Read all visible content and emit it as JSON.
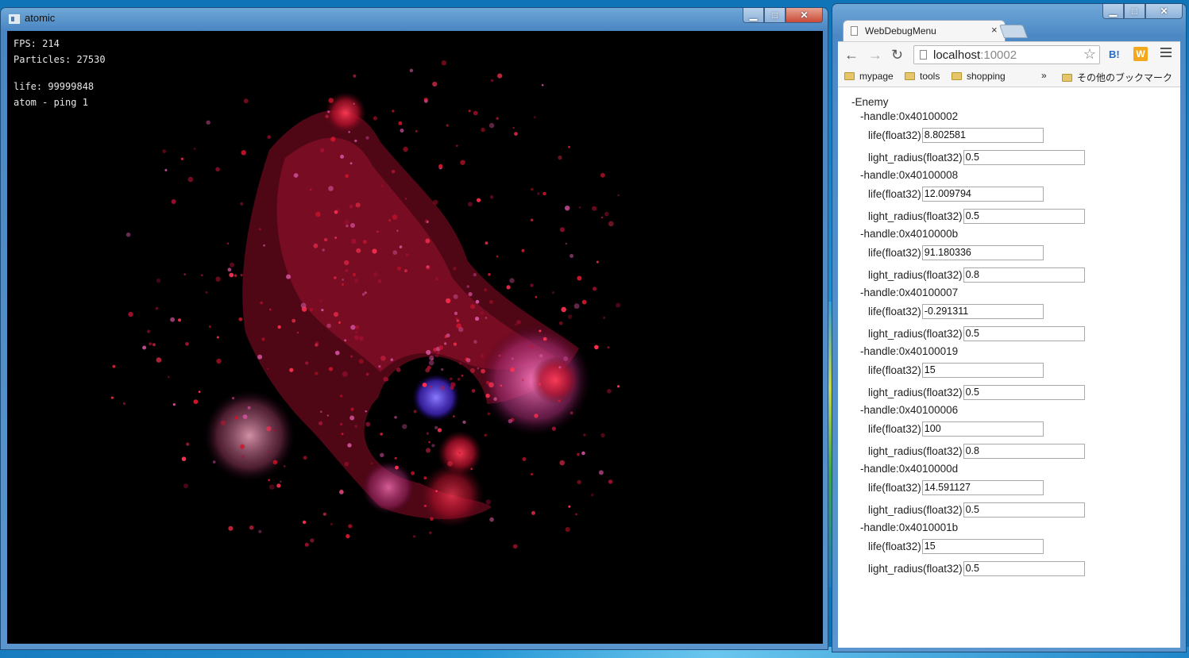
{
  "atomic_window": {
    "title": "atomic",
    "hud": {
      "fps": "FPS: 214",
      "particles": "Particles: 27530",
      "life": "life: 99999848",
      "status": "atom - ping 1"
    }
  },
  "browser": {
    "tab_title": "WebDebugMenu",
    "tab_close": "×",
    "url_host": "localhost",
    "url_port": ":10002",
    "ext_b": "B!",
    "ext_w": "W",
    "bookmarks": [
      {
        "label": "mypage"
      },
      {
        "label": "tools"
      },
      {
        "label": "shopping"
      }
    ],
    "bookmarks_more": "»",
    "bookmarks_other": "その他のブックマーク"
  },
  "debug_menu": {
    "root_label": "-Enemy",
    "life_label": "life(float32)",
    "radius_label": "light_radius(float32)",
    "handles": [
      {
        "label": "-handle:0x40100002",
        "life": "8.802581",
        "light_radius": "0.5"
      },
      {
        "label": "-handle:0x40100008",
        "life": "12.009794",
        "light_radius": "0.5"
      },
      {
        "label": "-handle:0x4010000b",
        "life": "91.180336",
        "light_radius": "0.8"
      },
      {
        "label": "-handle:0x40100007",
        "life": "-0.291311",
        "light_radius": "0.5"
      },
      {
        "label": "-handle:0x40100019",
        "life": "15",
        "light_radius": "0.5"
      },
      {
        "label": "-handle:0x40100006",
        "life": "100",
        "light_radius": "0.8"
      },
      {
        "label": "-handle:0x4010000d",
        "life": "14.591127",
        "light_radius": "0.5"
      },
      {
        "label": "-handle:0x4010001b",
        "life": "15",
        "light_radius": "0.5"
      }
    ]
  },
  "colors": {
    "particle_red": "#d0142c",
    "particle_magenta": "#d0509a",
    "particle_blue": "#5a3cff",
    "title_bar": "#4a86c2"
  }
}
